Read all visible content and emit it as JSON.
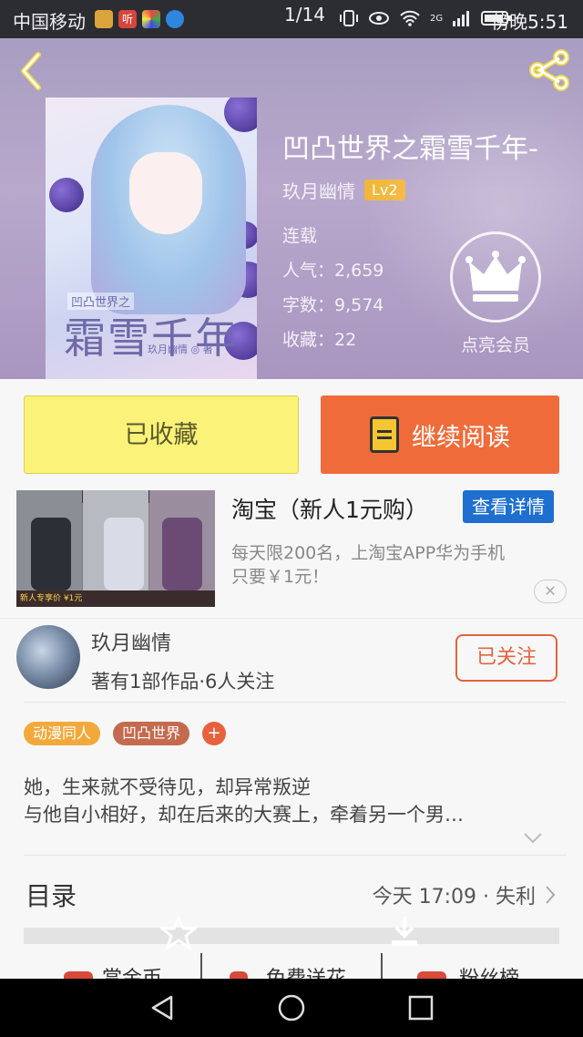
{
  "status_bar": {
    "carrier": "中国移动",
    "app_icon_ting": "听",
    "pager": "1/14",
    "network": "2G",
    "time": "傍晚5:51"
  },
  "book": {
    "title": "凹凸世界之霜雪千年-",
    "author": "玖月幽情",
    "level": "Lv2",
    "status": "连载",
    "popularity": "人气：2,659",
    "word_count": "字数：9,574",
    "favorites": "收藏：22",
    "vip_label": "点亮会员",
    "cover": {
      "subtitle": "凹凸世界之",
      "title": "霜雪千年",
      "author": "玖月幽情 ◎ 著"
    }
  },
  "actions": {
    "favorited_label": "已收藏",
    "continue_label": "继续阅读"
  },
  "ad": {
    "title": "淘宝（新人1元购）",
    "button": "查看详情",
    "description_line1": "每天限200名，上淘宝APP华为手机",
    "description_line2": "只要￥1元！",
    "close": "✕",
    "panel_caption": "新人专享价 ¥1元"
  },
  "author_card": {
    "name": "玖月幽情",
    "summary": "著有1部作品·6人关注",
    "follow_label": "已关注"
  },
  "tags": [
    {
      "label": "动漫同人",
      "color": "#f2a93b"
    },
    {
      "label": "凹凸世界",
      "color": "#c46a4e"
    }
  ],
  "tag_add": "+",
  "synopsis": {
    "line1": "她，生来就不受待见，却异常叛逆",
    "line2": "与他自小相好，却在后来的大赛上，牵着另一个男…"
  },
  "catalog": {
    "label": "目录",
    "latest": "今天 17:09 · 失利"
  },
  "bottom_row": [
    "赏金币",
    "免费送花",
    "粉丝榜"
  ],
  "colors": {
    "accent_orange": "#ef6c3a",
    "favorite_yellow": "#fbf27a",
    "ad_blue": "#1f6fd0",
    "lv_badge": "#f2b73a"
  }
}
